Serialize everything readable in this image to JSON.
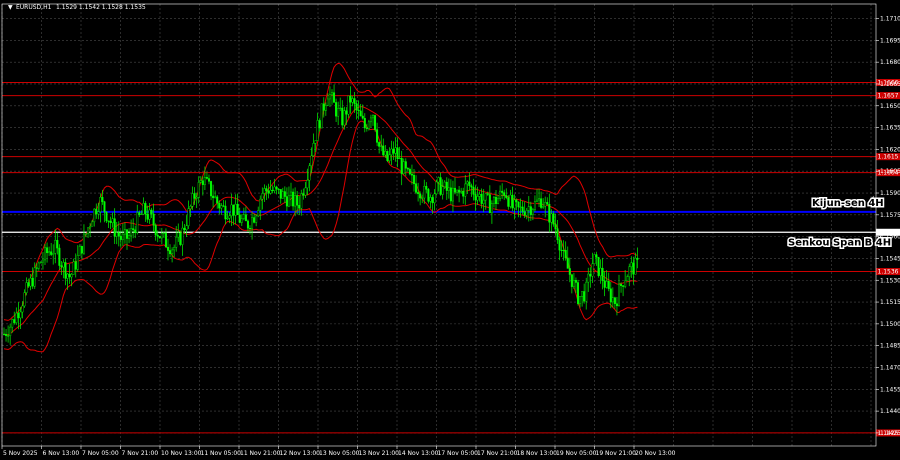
{
  "header": {
    "symbol": "EURUSD,H1",
    "ohlc": "1.1529 1.1542 1.1528 1.1535"
  },
  "colors": {
    "background": "#000000",
    "grid": "#4a4a4a",
    "candle": "#00ff00",
    "bollinger": "#e00000",
    "kijun": "#0000ff",
    "senkou": "#ffffff",
    "level": "#cc0000"
  },
  "chart_data": {
    "type": "candlestick",
    "y_ticks": [
      "1.1710",
      "1.1695",
      "1.1680",
      "1.1665",
      "1.1650",
      "1.1635",
      "1.1620",
      "1.1605",
      "1.1590",
      "1.1575",
      "1.1560",
      "1.1545",
      "1.1530",
      "1.1515",
      "1.1500",
      "1.1485",
      "1.1470",
      "1.1455",
      "1.1440",
      "1.1425"
    ],
    "ylim": [
      1.1416,
      1.172
    ],
    "x_ticks": [
      "5 Nov 2025",
      "6 Nov 13:00",
      "7 Nov 05:00",
      "7 Nov 21:00",
      "10 Nov 13:00",
      "11 Nov 05:00",
      "11 Nov 21:00",
      "12 Nov 13:00",
      "13 Nov 05:00",
      "13 Nov 21:00",
      "14 Nov 13:00",
      "17 Nov 05:00",
      "17 Nov 21:00",
      "18 Nov 13:00",
      "19 Nov 05:00",
      "19 Nov 21:00",
      "20 Nov 13:00"
    ],
    "levels": [
      {
        "value": 1.1666,
        "label": "1.1666",
        "color": "#cc0000"
      },
      {
        "value": 1.1657,
        "label": "1.1657",
        "color": "#cc0000"
      },
      {
        "value": 1.1615,
        "label": "1.1615",
        "color": "#cc0000"
      },
      {
        "value": 1.1604,
        "label": "1.1604",
        "color": "#cc0000"
      },
      {
        "value": 1.1536,
        "label": "1.1536",
        "color": "#cc0000"
      },
      {
        "value": 1.1425,
        "label": "1.1425",
        "color": "#cc0000"
      },
      {
        "value": 1.1563,
        "label": "1.1563",
        "color": "#ffffff"
      }
    ],
    "kijun_value": 1.1577,
    "annotations": [
      {
        "text": "Kijun-sen 4H",
        "color": "#0000ff"
      },
      {
        "text": "Senkou Span B 4H",
        "color": "#ffffff"
      }
    ],
    "price_path": [
      1.1493,
      1.15,
      1.151,
      1.1522,
      1.1532,
      1.1543,
      1.155,
      1.1552,
      1.154,
      1.1532,
      1.1545,
      1.156,
      1.1575,
      1.1585,
      1.1575,
      1.1565,
      1.1558,
      1.156,
      1.157,
      1.1578,
      1.1572,
      1.1562,
      1.1556,
      1.1552,
      1.156,
      1.1575,
      1.159,
      1.16,
      1.1592,
      1.1583,
      1.1578,
      1.158,
      1.1572,
      1.1568,
      1.1575,
      1.159,
      1.1593,
      1.159,
      1.1588,
      1.1585,
      1.1582,
      1.16,
      1.1625,
      1.1643,
      1.166,
      1.1648,
      1.164,
      1.1655,
      1.1645,
      1.1635,
      1.1648,
      1.162,
      1.1612,
      1.162,
      1.1608,
      1.16,
      1.1595,
      1.159,
      1.1588,
      1.1595,
      1.1592,
      1.1588,
      1.159,
      1.1596,
      1.159,
      1.1586,
      1.1582,
      1.1586,
      1.1592,
      1.158,
      1.1578,
      1.158,
      1.1582,
      1.1586,
      1.1575,
      1.1565,
      1.1545,
      1.1532,
      1.1518,
      1.1522,
      1.1545,
      1.1535,
      1.1522,
      1.1515,
      1.153,
      1.1538,
      1.154
    ]
  }
}
